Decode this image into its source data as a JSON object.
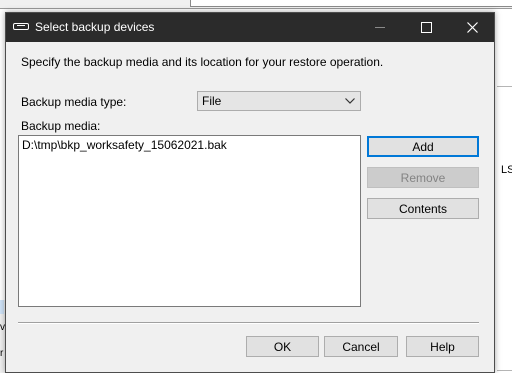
{
  "dialog": {
    "title": "Select backup devices",
    "instruction": "Specify the backup media and its location for your restore operation.",
    "media_type_label": "Backup media type:",
    "media_type_value": "File",
    "media_list_label": "Backup media:",
    "media_items": [
      "D:\\tmp\\bkp_worksafety_15062021.bak"
    ],
    "buttons": {
      "add": "Add",
      "remove": "Remove",
      "contents": "Contents",
      "ok": "OK",
      "cancel": "Cancel",
      "help": "Help"
    }
  },
  "background": {
    "right_text": "LS",
    "left_text_1": "v",
    "left_text_2": "r"
  },
  "colors": {
    "titlebar": "#2b2b2b",
    "dialog_bg": "#f0f0f0",
    "focus_accent": "#0078d7"
  },
  "icons": {
    "title": "device-icon",
    "dropdown": "chevron-down-icon",
    "minimize": "minimize-icon",
    "maximize": "maximize-icon",
    "close": "close-icon"
  }
}
